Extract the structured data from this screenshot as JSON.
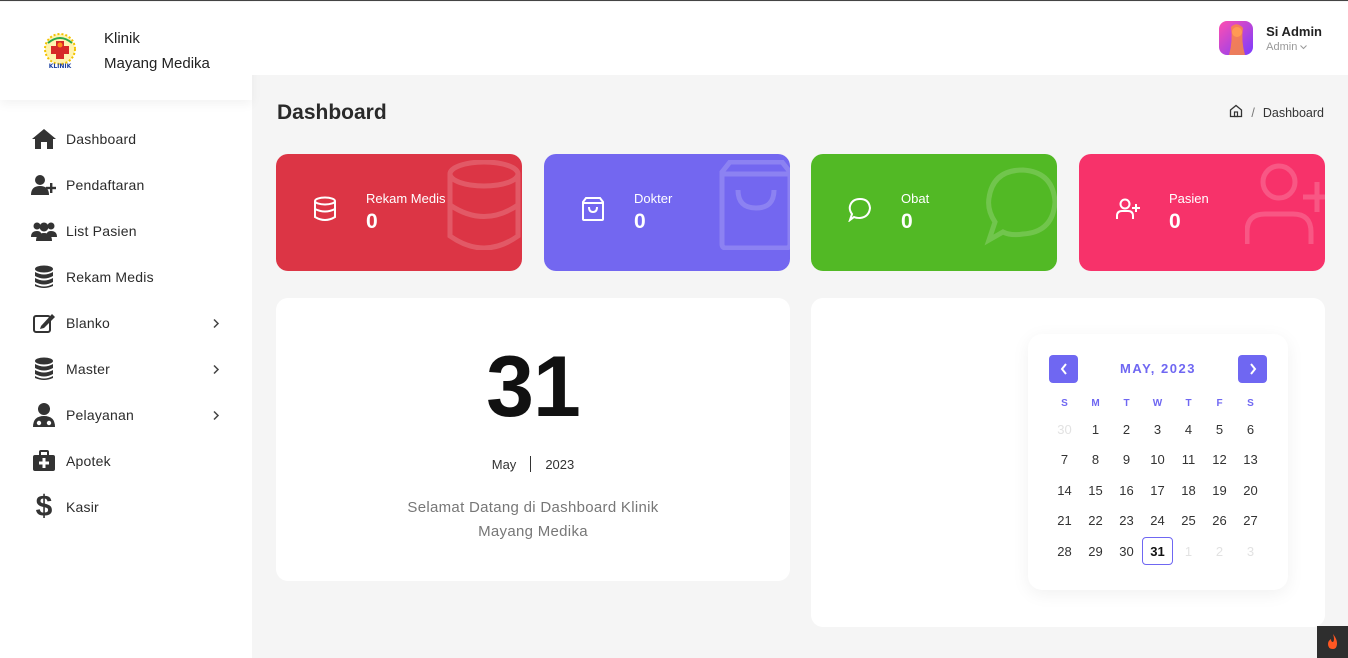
{
  "brand": {
    "line1": "Klinik",
    "line2": "Mayang Medika",
    "logo_text": "KLINIK"
  },
  "sidebar": {
    "items": [
      {
        "label": "Dashboard",
        "icon": "home-icon"
      },
      {
        "label": "Pendaftaran",
        "icon": "user-plus-icon"
      },
      {
        "label": "List Pasien",
        "icon": "users-icon"
      },
      {
        "label": "Rekam Medis",
        "icon": "database-icon"
      },
      {
        "label": "Blanko",
        "icon": "edit-icon",
        "has_submenu": true
      },
      {
        "label": "Master",
        "icon": "database-icon",
        "has_submenu": true
      },
      {
        "label": "Pelayanan",
        "icon": "doctor-icon",
        "has_submenu": true
      },
      {
        "label": "Apotek",
        "icon": "medkit-icon"
      },
      {
        "label": "Kasir",
        "icon": "dollar-icon"
      }
    ]
  },
  "header": {
    "user_name": "Si Admin",
    "user_role": "Admin"
  },
  "page": {
    "title": "Dashboard",
    "breadcrumb": [
      "Dashboard"
    ]
  },
  "stats": [
    {
      "label": "Rekam Medis",
      "value": "0",
      "color": "#dc3545",
      "icon": "database-icon"
    },
    {
      "label": "Dokter",
      "value": "0",
      "color": "#7367f0",
      "icon": "shopping-bag-icon"
    },
    {
      "label": "Obat",
      "value": "0",
      "color": "#52b925",
      "icon": "message-circle-icon"
    },
    {
      "label": "Pasien",
      "value": "0",
      "color": "#f7326a",
      "icon": "user-plus-icon"
    }
  ],
  "date_panel": {
    "day": "31",
    "month": "May",
    "year": "2023",
    "welcome_1": "Selamat Datang di Dashboard Klinik",
    "welcome_2": "Mayang Medika"
  },
  "calendar": {
    "title": "MAY, 2023",
    "weekdays": [
      "S",
      "M",
      "T",
      "W",
      "T",
      "F",
      "S"
    ],
    "days": [
      {
        "d": "30",
        "muted": true
      },
      {
        "d": "1"
      },
      {
        "d": "2"
      },
      {
        "d": "3"
      },
      {
        "d": "4"
      },
      {
        "d": "5"
      },
      {
        "d": "6"
      },
      {
        "d": "7"
      },
      {
        "d": "8"
      },
      {
        "d": "9"
      },
      {
        "d": "10"
      },
      {
        "d": "11"
      },
      {
        "d": "12"
      },
      {
        "d": "13"
      },
      {
        "d": "14"
      },
      {
        "d": "15"
      },
      {
        "d": "16"
      },
      {
        "d": "17"
      },
      {
        "d": "18"
      },
      {
        "d": "19"
      },
      {
        "d": "20"
      },
      {
        "d": "21"
      },
      {
        "d": "22"
      },
      {
        "d": "23"
      },
      {
        "d": "24"
      },
      {
        "d": "25"
      },
      {
        "d": "26"
      },
      {
        "d": "27"
      },
      {
        "d": "28"
      },
      {
        "d": "29"
      },
      {
        "d": "30"
      },
      {
        "d": "31",
        "today": true
      },
      {
        "d": "1",
        "muted": true
      },
      {
        "d": "2",
        "muted": true
      },
      {
        "d": "3",
        "muted": true
      }
    ],
    "accent": "#6f67f2"
  }
}
